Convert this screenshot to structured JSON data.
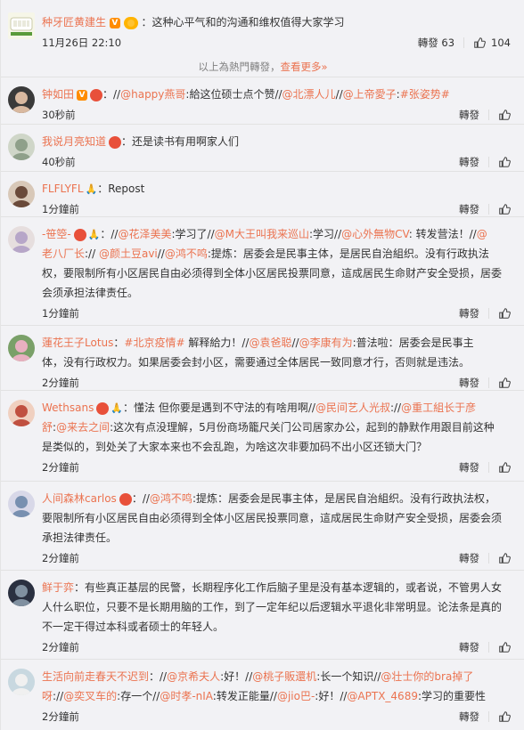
{
  "top_comment": {
    "username": "种牙匠黄建生",
    "text": "：这种心平气和的沟通和维权值得大家学习",
    "time": "11月26日 22:10",
    "repost_label": "轉發 63",
    "likes": "104"
  },
  "hot_divider": {
    "text": "以上為熱門轉發，",
    "more": "查看更多»"
  },
  "comments": [
    {
      "username": "钟如田",
      "segments": [
        {
          "t": "：//",
          "c": "txt"
        },
        {
          "t": "@happy燕哥",
          "c": "at"
        },
        {
          "t": ":給这位硕士点个赞",
          "c": "txt"
        },
        {
          "t": "//",
          "c": "txt"
        },
        {
          "t": "@北漂人儿",
          "c": "at"
        },
        {
          "t": "//",
          "c": "txt"
        },
        {
          "t": "@上帝愛子",
          "c": "at"
        },
        {
          "t": ":",
          "c": "txt"
        },
        {
          "t": "#张姿势#",
          "c": "at"
        }
      ],
      "time": "30秒前",
      "repost": "轉發",
      "like": "赞"
    },
    {
      "username": "我说月亮知道",
      "segments": [
        {
          "t": "：还是读书有用啊家人们",
          "c": "txt"
        }
      ],
      "time": "40秒前",
      "repost": "轉發",
      "like": "赞"
    },
    {
      "username": "FLFLYFL",
      "segments": [
        {
          "t": "：Repost",
          "c": "txt"
        }
      ],
      "time": "1分鐘前",
      "repost": "轉發",
      "like": "赞"
    },
    {
      "username": "-笹箜-",
      "lines": [
        [
          {
            "t": "：//",
            "c": "txt"
          },
          {
            "t": "@花泽美美",
            "c": "at"
          },
          {
            "t": ":学习了//",
            "c": "txt"
          },
          {
            "t": "@M大王叫我来巡山",
            "c": "at"
          },
          {
            "t": ":学习//",
            "c": "txt"
          },
          {
            "t": "@心外無物CV",
            "c": "at"
          },
          {
            "t": ": 转发营法！//",
            "c": "txt"
          },
          {
            "t": "@",
            "c": "at"
          }
        ],
        [
          {
            "t": "老八厂长",
            "c": "at"
          },
          {
            "t": ":// ",
            "c": "txt"
          },
          {
            "t": "@颜土豆avi",
            "c": "at"
          },
          {
            "t": "//",
            "c": "txt"
          },
          {
            "t": "@鸿不鸣",
            "c": "at"
          },
          {
            "t": ":提炼：居委会是民事主体，是居民自治組织。没有行政执法",
            "c": "txt"
          }
        ],
        [
          {
            "t": "权，要限制所有小区居民自由必须得到全体小区居民投票同意，這成居民生命财产安全受损，居委",
            "c": "txt"
          }
        ],
        [
          {
            "t": "会须承担法律责任。",
            "c": "txt"
          }
        ]
      ],
      "time": "1分鐘前",
      "repost": "轉發",
      "like": "赞"
    },
    {
      "username": "蓮花王子Lotus",
      "lines": [
        [
          {
            "t": "：",
            "c": "txt"
          },
          {
            "t": "#北京疫情#",
            "c": "at"
          },
          {
            "t": " 解释給力！",
            "c": "txt"
          },
          {
            "t": "//",
            "c": "txt"
          },
          {
            "t": "@袁爸聪",
            "c": "at"
          },
          {
            "t": "//",
            "c": "txt"
          },
          {
            "t": "@李康有为",
            "c": "at"
          },
          {
            "t": ":普法啦：居委会是民事主",
            "c": "txt"
          }
        ],
        [
          {
            "t": "体，没有行政权力。如果居委会封小区，需要通过全体居民一致同意才行，否则就是违法。",
            "c": "txt"
          }
        ]
      ],
      "time": "2分鐘前",
      "repost": "轉發",
      "like": "赞"
    },
    {
      "username": "Wethsans",
      "lines": [
        [
          {
            "t": "：懂法 但你要是遇到不守法的有啥用啊//",
            "c": "txt"
          },
          {
            "t": "@民间艺人光叔",
            "c": "at"
          },
          {
            "t": ":",
            "c": "txt"
          },
          {
            "t": "//",
            "c": "txt"
          },
          {
            "t": "@重工組长于彦",
            "c": "at"
          }
        ],
        [
          {
            "t": "舒",
            "c": "at"
          },
          {
            "t": ":",
            "c": "txt"
          },
          {
            "t": "@来去之间",
            "c": "at"
          },
          {
            "t": ":这次有点没理解，5月份商场籠尺关门公司居家办公，起到的静默作用跟目前这种",
            "c": "txt"
          }
        ],
        [
          {
            "t": "是类似的，到处关了大家本来也不会乱跑，为啥这次非要加码不出小区还锁大门？",
            "c": "txt"
          }
        ]
      ],
      "time": "2分鐘前",
      "repost": "轉發",
      "like": "赞"
    },
    {
      "username": "人间森林carlos",
      "lines": [
        [
          {
            "t": "：//",
            "c": "txt"
          },
          {
            "t": "@鸿不鸣",
            "c": "at"
          },
          {
            "t": ":提炼：居委会是民事主体，是居民自治組织。没有行政执法权，",
            "c": "txt"
          }
        ],
        [
          {
            "t": "要限制所有小区居民自由必须得到全体小区居民投票同意，這成居民生命财产安全受损，居委会须",
            "c": "txt"
          }
        ],
        [
          {
            "t": "承担法律责任。",
            "c": "txt"
          }
        ]
      ],
      "time": "2分鐘前",
      "repost": "轉發",
      "like": "赞"
    },
    {
      "username": "鲜于弈",
      "lines": [
        [
          {
            "t": "：有些真正基层的民警，长期程序化工作后脑子里是没有基本逻辑的，或者说，不管男人女",
            "c": "txt"
          }
        ],
        [
          {
            "t": "人什么职位，只要不是长期用脑的工作，到了一定年纪以后逻辑水平退化非常明显。论法条是真的",
            "c": "txt"
          }
        ],
        [
          {
            "t": "不一定干得过本科或者硕士的年轻人。",
            "c": "txt"
          }
        ]
      ],
      "time": "2分鐘前",
      "repost": "轉發",
      "like": "赞"
    },
    {
      "username": "生活向前走春天不迟到",
      "lines": [
        [
          {
            "t": "：//",
            "c": "txt"
          },
          {
            "t": "@京希夫人",
            "c": "at"
          },
          {
            "t": ":好！//",
            "c": "txt"
          },
          {
            "t": "@桃子販還机",
            "c": "at"
          },
          {
            "t": ":长一个知识",
            "c": "txt"
          },
          {
            "t": "//",
            "c": "txt"
          },
          {
            "t": "@壮士你的bra掉了",
            "c": "at"
          }
        ],
        [
          {
            "t": "呀",
            "c": "at"
          },
          {
            "t": ":",
            "c": "txt"
          },
          {
            "t": "//",
            "c": "txt"
          },
          {
            "t": "@奕叉车的",
            "c": "at"
          },
          {
            "t": ":存一个//",
            "c": "txt"
          },
          {
            "t": "@时孝-nIA",
            "c": "at"
          },
          {
            "t": ":转发正能量//",
            "c": "txt"
          },
          {
            "t": "@jio巴-",
            "c": "at"
          },
          {
            "t": ":好！//",
            "c": "txt"
          },
          {
            "t": "@APTX_4689",
            "c": "at"
          },
          {
            "t": ":学习的重要性",
            "c": "txt"
          }
        ]
      ],
      "time": "2分鐘前",
      "repost": "轉發",
      "like": "赞"
    }
  ]
}
